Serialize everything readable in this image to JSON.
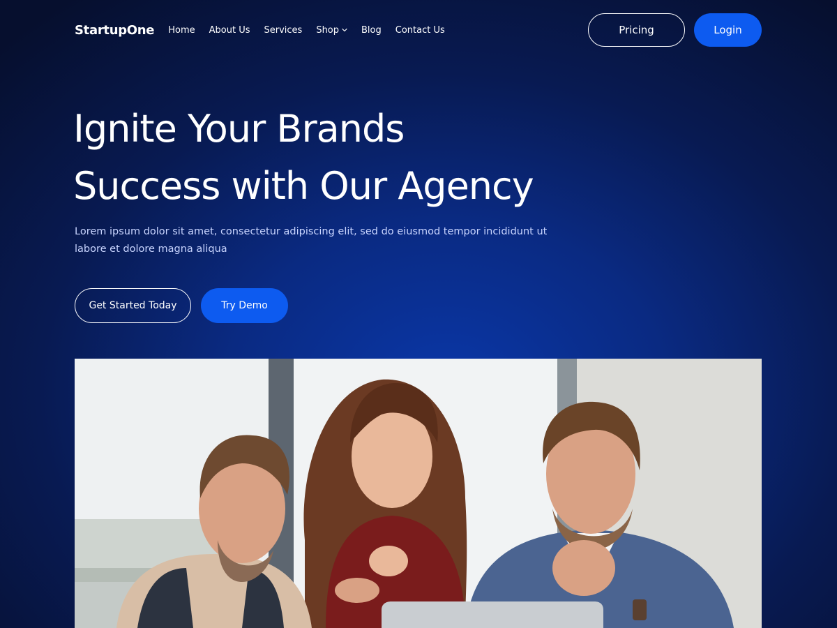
{
  "brand": {
    "name": "StartupOne"
  },
  "nav": {
    "links": [
      {
        "label": "Home"
      },
      {
        "label": "About Us"
      },
      {
        "label": "Services"
      },
      {
        "label": "Shop",
        "dropdown": true,
        "icon": "chevron-down-icon"
      },
      {
        "label": "Blog"
      },
      {
        "label": "Contact Us"
      }
    ],
    "pricing_label": "Pricing",
    "login_label": "Login"
  },
  "hero": {
    "title_line1": "Ignite Your Brands",
    "title_line2": "Success with Our Agency",
    "subtitle": "Lorem ipsum dolor sit amet, consectetur adipiscing elit, sed do eiusmod tempor incididunt ut labore et dolore magna aliqua",
    "primary_cta": "Get Started Today",
    "secondary_cta": "Try Demo",
    "image": "team-meeting-photo"
  },
  "colors": {
    "accent": "#0d5bf0",
    "background_dark": "#060f2e",
    "background_glow": "#0a37a8",
    "subtitle_text": "#c9d5ff"
  }
}
